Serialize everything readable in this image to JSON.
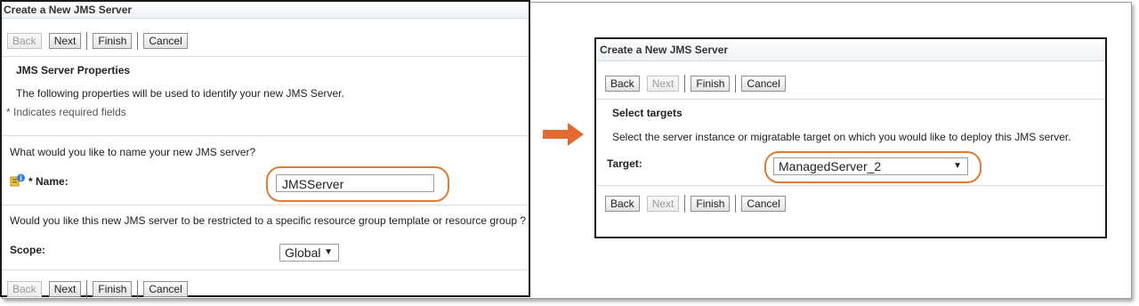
{
  "left_panel": {
    "title": "Create a New JMS Server",
    "buttons": {
      "back": "Back",
      "next": "Next",
      "finish": "Finish",
      "cancel": "Cancel"
    },
    "section_title": "JMS Server Properties",
    "description": "The following properties will be used to identify your new JMS Server.",
    "required_note": "* Indicates required fields",
    "name_question": "What would you like to name your new JMS server?",
    "name_label": "* Name:",
    "name_value": "JMSServer",
    "scope_question": "Would you like this new JMS server to be restricted to a specific resource group template or resource group ?",
    "scope_label": "Scope:",
    "scope_value": "Global",
    "scope_caret": "▼"
  },
  "right_panel": {
    "title": "Create a New JMS Server",
    "buttons": {
      "back": "Back",
      "next": "Next",
      "finish": "Finish",
      "cancel": "Cancel"
    },
    "section_title": "Select targets",
    "description": "Select the server instance or migratable target on which you would like to deploy this JMS server.",
    "target_label": "Target:",
    "target_value": "ManagedServer_2",
    "target_caret": "▼"
  },
  "arrow_icon": "right-arrow-icon",
  "colors": {
    "highlight": "#e07a35",
    "arrow": "#e36a33"
  }
}
